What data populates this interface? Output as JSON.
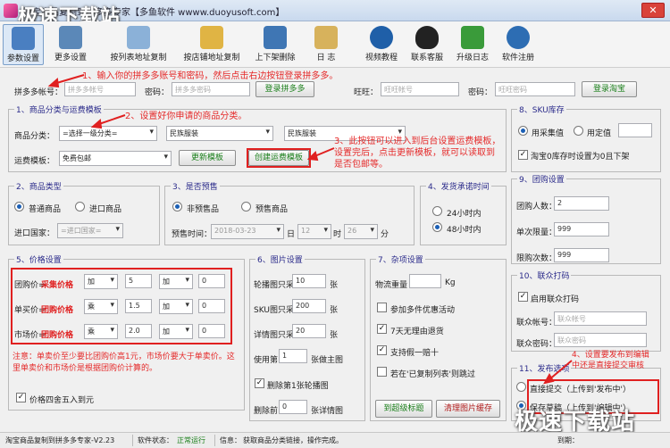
{
  "window": {
    "title": "淘宝商品复制到拼多多专家【多鱼软件 wwww.duoyusoft.com】",
    "watermark": "极速下载站",
    "close": "✕"
  },
  "toolbar": [
    {
      "label": "参数设置",
      "icon": "gear-icon",
      "color": "#4a7fc1"
    },
    {
      "label": "更多设置",
      "icon": "gears-icon",
      "color": "#5b88b8"
    },
    {
      "label": "按列表地址复制",
      "icon": "list-icon",
      "color": "#8bb1d8"
    },
    {
      "label": "按店铺地址复制",
      "icon": "folder-icon",
      "color": "#e0b444"
    },
    {
      "label": "上下架删除",
      "icon": "updown-icon",
      "color": "#3f76b4"
    },
    {
      "label": "日  志",
      "icon": "log-icon",
      "color": "#d7b25c"
    },
    {
      "label": "视频教程",
      "icon": "play-icon",
      "color": "#1f5fa8"
    },
    {
      "label": "联系客服",
      "icon": "qq-icon",
      "color": "#222222"
    },
    {
      "label": "升级日志",
      "icon": "upgrade-icon",
      "color": "#3a9b3a"
    },
    {
      "label": "软件注册",
      "icon": "lock-icon",
      "color": "#2d6db3"
    }
  ],
  "annotations": {
    "a1": "1、输入你的拼多多账号和密码，然后点击右边按钮登录拼多多。",
    "a2": "2、设置好你申请的商品分类。",
    "a3": "3、此按钮可以进入到后台设置运费模板，\n设置完后，点击更新模板，就可以读取到\n是否包邮等。",
    "a4": "4、设置要发布到编辑\n中还是直接提交审核",
    "a5": "注意：单卖价至少要比团购价高1元，市场价要大于单卖价。这\n里单卖价和市场价是根据团购价计算的。"
  },
  "login": {
    "pdd_account_label": "拼多多帐号：",
    "pdd_account_ph": "拼多多帐号",
    "pwd_label": "密码：",
    "pdd_pwd_ph": "拼多多密码",
    "pdd_login": "登录拼多多",
    "ww_label": "旺旺：",
    "ww_ph": "旺旺帐号",
    "ww_pwd_label": "密码：",
    "ww_pwd_ph": "旺旺密码",
    "tb_login": "登录淘宝"
  },
  "category": {
    "title": "1、商品分类与运费模板",
    "cat_label": "商品分类：",
    "cat1": "=选择一级分类=",
    "cat2": "民族服装",
    "cat3": "民族服装",
    "ship_label": "运费模板：",
    "ship_value": "免费包邮",
    "update_btn": "更新模板",
    "create_btn": "创建运费模板"
  },
  "sku": {
    "title": "8、SKU库存",
    "opt1": "用采集值",
    "opt2": "用定值",
    "stock_zero": "淘宝0库存时设置为0且下架"
  },
  "goods_type": {
    "title": "2、商品类型",
    "opt1": "普通商品",
    "opt2": "进口商品",
    "country_label": "进口国家：",
    "country_ph": "=进口国家="
  },
  "presale": {
    "title": "3、是否预售",
    "opt1": "非预售品",
    "opt2": "预售商品",
    "time_label": "预售时间：",
    "date": "2018-03-23",
    "day_label": "日",
    "hour": "12",
    "hour_label": "时",
    "min": "26",
    "min_label": "分"
  },
  "delivery": {
    "title": "4、发货承诺时间",
    "opt1": "24小时内",
    "opt2": "48小时内"
  },
  "group": {
    "title": "9、团购设置",
    "people_label": "团购人数：",
    "people": "2",
    "single_label": "单次限量：",
    "single": "999",
    "limit_label": "限购次数：",
    "limit": "999"
  },
  "price": {
    "title": "5、价格设置",
    "rows": [
      {
        "label": "团购价=",
        "target": "采集价格",
        "op1": "加",
        "v1": "5",
        "op2": "加",
        "v2": "0"
      },
      {
        "label": "单买价=",
        "target": "团购价格",
        "op1": "乘",
        "v1": "1.5",
        "op2": "加",
        "v2": "0"
      },
      {
        "label": "市场价=",
        "target": "团购价格",
        "op1": "乘",
        "v1": "2.0",
        "op2": "加",
        "v2": "0"
      }
    ],
    "round": "价格四舍五入到元"
  },
  "image": {
    "title": "6、图片设置",
    "carousel_label": "轮播图只采",
    "carousel": "10",
    "carousel_unit": "张",
    "sku_label": "SKU图只采",
    "sku": "200",
    "sku_unit": "张",
    "detail_label": "详情图只采",
    "detail": "20",
    "detail_unit": "张",
    "use_label": "使用第",
    "use": "1",
    "use_unit": "张做主图",
    "del_first": "删除第1张轮播图",
    "del_label": "删除前",
    "del": "0",
    "del_unit": "张详情图"
  },
  "misc": {
    "title": "7、杂项设置",
    "weight_label": "物流重量",
    "weight_unit": "Kg",
    "c1": "参加多件优惠活动",
    "c2": "7天无理由退货",
    "c3": "支持假一赔十",
    "c4": "若在'已复制列表'则跳过",
    "btn1": "到超级标题",
    "btn2": "清理图片缓存"
  },
  "union": {
    "title": "10、联众打码",
    "enable": "启用联众打码",
    "acc_label": "联众帐号：",
    "acc_ph": "联众帐号",
    "pwd_label": "联众密码：",
    "pwd_ph": "联众密码"
  },
  "publish": {
    "title": "11、发布选项",
    "opt1": "直接提交（上传到'发布中'）",
    "opt2": "保存草稿（上传到'编辑中'）"
  },
  "status": {
    "app": "淘宝商品复制到拼多多专家-V2.23",
    "state_label": "软件状态：",
    "state": "正常运行",
    "info_label": "信息：",
    "info": "获取商品分类链接，操作完成。",
    "right": "到期："
  }
}
